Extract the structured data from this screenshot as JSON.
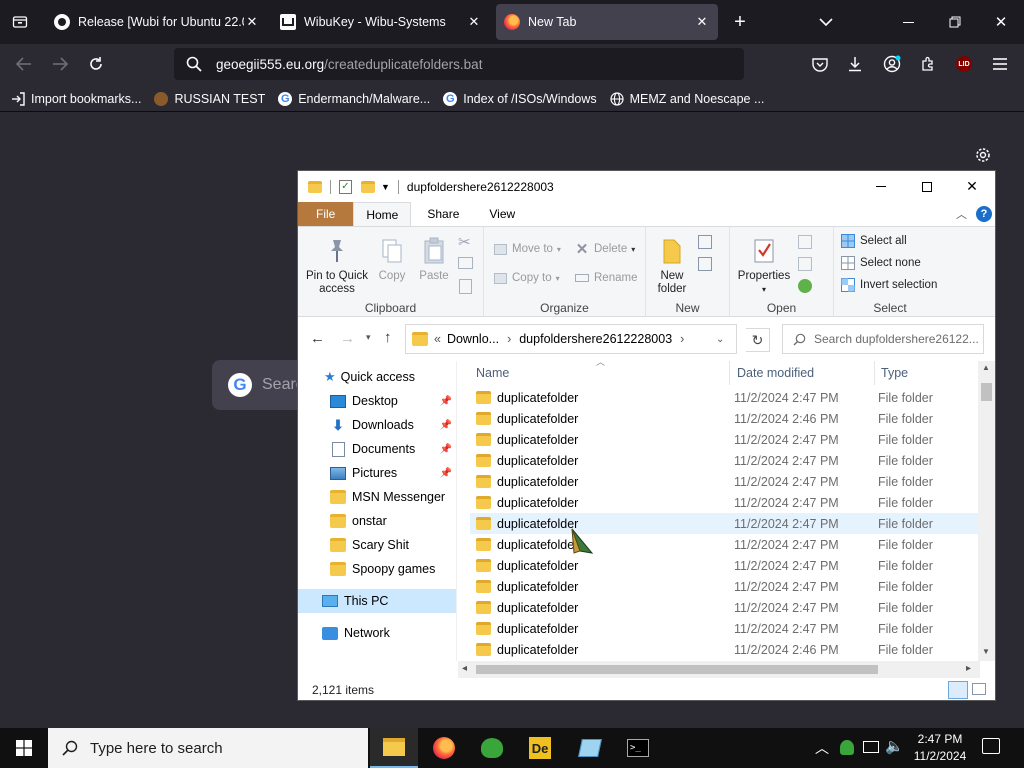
{
  "browser": {
    "tabs": [
      {
        "label": "Release [Wubi for Ubuntu 22.04",
        "icon": "github-icon"
      },
      {
        "label": "WibuKey - Wibu-Systems",
        "icon": "wibu-icon"
      },
      {
        "label": "New Tab",
        "icon": "firefox-icon",
        "active": true
      }
    ],
    "url_host": "geoegii555.eu.org",
    "url_path": "/createduplicatefolders.bat",
    "bookmarks": [
      {
        "label": "Import bookmarks...",
        "icon": "import-icon"
      },
      {
        "label": "RUSSIAN TEST",
        "icon": "bear-icon"
      },
      {
        "label": "Endermanch/Malware...",
        "icon": "google-icon"
      },
      {
        "label": "Index of /ISOs/Windows",
        "icon": "google-icon"
      },
      {
        "label": "MEMZ and Noescape ...",
        "icon": "globe-icon"
      }
    ],
    "newtab_search_placeholder": "Searc",
    "profile_badge": "LID"
  },
  "explorer": {
    "title": "dupfoldershere2612228003",
    "ribbon_tabs": [
      "File",
      "Home",
      "Share",
      "View"
    ],
    "clipboard": {
      "pin": "Pin to Quick access",
      "copy": "Copy",
      "paste": "Paste",
      "label": "Clipboard"
    },
    "organize": {
      "move_to": "Move to",
      "copy_to": "Copy to",
      "delete": "Delete",
      "rename": "Rename",
      "label": "Organize"
    },
    "new": {
      "new_folder": "New folder",
      "label": "New"
    },
    "open": {
      "properties": "Properties",
      "label": "Open"
    },
    "select": {
      "select_all": "Select all",
      "select_none": "Select none",
      "invert": "Invert selection",
      "label": "Select"
    },
    "breadcrumb": {
      "prefix": "«",
      "parent": "Downlo...",
      "current": "dupfoldershere2612228003"
    },
    "search_placeholder": "Search dupfoldershere26122...",
    "nav": {
      "quick_access": "Quick access",
      "items": [
        {
          "label": "Desktop",
          "pinned": true
        },
        {
          "label": "Downloads",
          "pinned": true
        },
        {
          "label": "Documents",
          "pinned": true
        },
        {
          "label": "Pictures",
          "pinned": true
        },
        {
          "label": "MSN Messenger"
        },
        {
          "label": "onstar"
        },
        {
          "label": "Scary Shit"
        },
        {
          "label": "Spoopy games"
        }
      ],
      "this_pc": "This PC",
      "network": "Network"
    },
    "columns": {
      "name": "Name",
      "date": "Date modified",
      "type": "Type"
    },
    "files": [
      {
        "name": "duplicatefolder",
        "date": "11/2/2024 2:47 PM",
        "type": "File folder"
      },
      {
        "name": "duplicatefolder",
        "date": "11/2/2024 2:46 PM",
        "type": "File folder"
      },
      {
        "name": "duplicatefolder",
        "date": "11/2/2024 2:47 PM",
        "type": "File folder"
      },
      {
        "name": "duplicatefolder",
        "date": "11/2/2024 2:47 PM",
        "type": "File folder"
      },
      {
        "name": "duplicatefolder",
        "date": "11/2/2024 2:47 PM",
        "type": "File folder"
      },
      {
        "name": "duplicatefolder",
        "date": "11/2/2024 2:47 PM",
        "type": "File folder"
      },
      {
        "name": "duplicatefolder",
        "date": "11/2/2024 2:47 PM",
        "type": "File folder"
      },
      {
        "name": "duplicatefolder",
        "date": "11/2/2024 2:47 PM",
        "type": "File folder"
      },
      {
        "name": "duplicatefolder",
        "date": "11/2/2024 2:47 PM",
        "type": "File folder"
      },
      {
        "name": "duplicatefolder",
        "date": "11/2/2024 2:47 PM",
        "type": "File folder"
      },
      {
        "name": "duplicatefolder",
        "date": "11/2/2024 2:47 PM",
        "type": "File folder"
      },
      {
        "name": "duplicatefolder",
        "date": "11/2/2024 2:47 PM",
        "type": "File folder"
      },
      {
        "name": "duplicatefolder",
        "date": "11/2/2024 2:46 PM",
        "type": "File folder"
      }
    ],
    "status": "2,121 items"
  },
  "taskbar": {
    "search_placeholder": "Type here to search",
    "time": "2:47 PM",
    "date": "11/2/2024"
  },
  "colors": {
    "accent": "#0078d7",
    "file_tab": "#b6793d",
    "folder": "#f5c94c",
    "browser_bg": "#2b2a33"
  }
}
